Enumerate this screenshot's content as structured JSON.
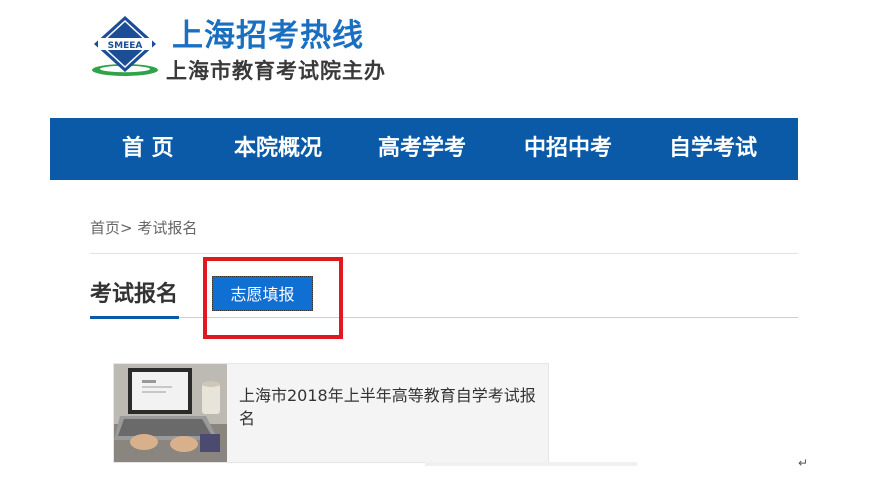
{
  "header": {
    "logo_icon": "smeea-logo-icon",
    "logo_text": "SMEEA",
    "title": "上海招考热线",
    "subtitle": "上海市教育考试院主办"
  },
  "nav": {
    "items": [
      {
        "label": "首 页"
      },
      {
        "label": "本院概况"
      },
      {
        "label": "高考学考"
      },
      {
        "label": "中招中考"
      },
      {
        "label": "自学考试"
      }
    ]
  },
  "breadcrumb": {
    "home": "首页",
    "separator": ">",
    "current": "考试报名"
  },
  "section": {
    "title": "考试报名",
    "tab_button": "志愿填报"
  },
  "cards": [
    {
      "title": "上海市2018年上半年高等教育自学考试报名"
    }
  ],
  "misc": {
    "return_mark": "↵"
  },
  "colors": {
    "brand_blue": "#0b5aa8",
    "title_blue": "#1a6fc0",
    "button_blue": "#0f6fd3",
    "highlight_red": "#e0181f"
  }
}
